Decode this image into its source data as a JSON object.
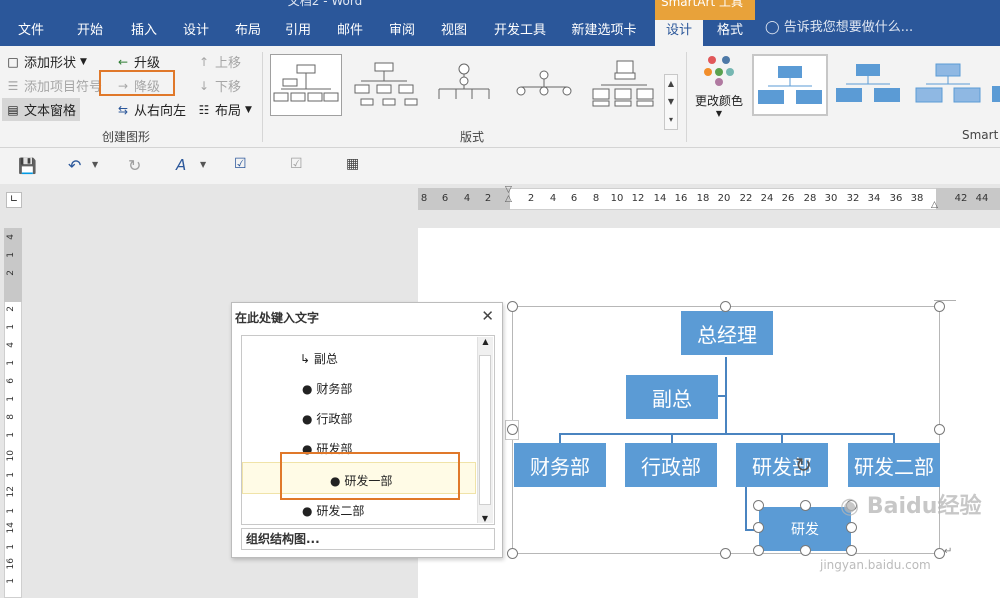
{
  "window": {
    "title": "文档2 - Word",
    "contextual_group": "SmartArt 工具"
  },
  "tabs": [
    "文件",
    "开始",
    "插入",
    "设计",
    "布局",
    "引用",
    "邮件",
    "审阅",
    "视图",
    "开发工具",
    "新建选项卡",
    "设计",
    "格式"
  ],
  "tellme": "告诉我您想要做什么...",
  "ribbon": {
    "create": {
      "add_shape": "添加形状",
      "add_bullet": "添加项目符号",
      "text_pane": "文本窗格",
      "promote": "升级",
      "demote": "降级",
      "rtl": "从右向左",
      "move_up": "上移",
      "move_down": "下移",
      "layout": "布局",
      "group_label": "创建图形"
    },
    "layouts_label": "版式",
    "change_colors": "更改颜色",
    "smart_label": "Smart"
  },
  "ruler": {
    "h_numbers": [
      "8",
      "6",
      "4",
      "2",
      "",
      "2",
      "4",
      "6",
      "8",
      "10",
      "12",
      "14",
      "16",
      "18",
      "20",
      "22",
      "24",
      "26",
      "28",
      "30",
      "32",
      "34",
      "36",
      "38",
      "",
      "42",
      "44"
    ],
    "v_numbers": [
      "4",
      "1",
      "2",
      "",
      "2",
      "1",
      "4",
      "1",
      "6",
      "1",
      "8",
      "1",
      "10",
      "1",
      "12",
      "1",
      "14",
      "1",
      "16",
      "1",
      "18"
    ]
  },
  "text_pane": {
    "title": "在此处键入文字",
    "items": [
      "副总",
      "财务部",
      "行政部",
      "研发部",
      "研发一部",
      "研发二部"
    ],
    "footer": "组织结构图..."
  },
  "smartart": {
    "top": "总经理",
    "assistant": "副总",
    "level2": [
      "财务部",
      "行政部",
      "研发部",
      "研发二部"
    ],
    "sub": "研发"
  },
  "watermark": {
    "brand": "Baidu经验",
    "url": "jingyan.baidu.com"
  },
  "colors": {
    "ribbon_blue": "#2b579a",
    "shape_fill": "#5b9bd5",
    "highlight": "#e0782a",
    "context_tab": "#e8a23a"
  }
}
